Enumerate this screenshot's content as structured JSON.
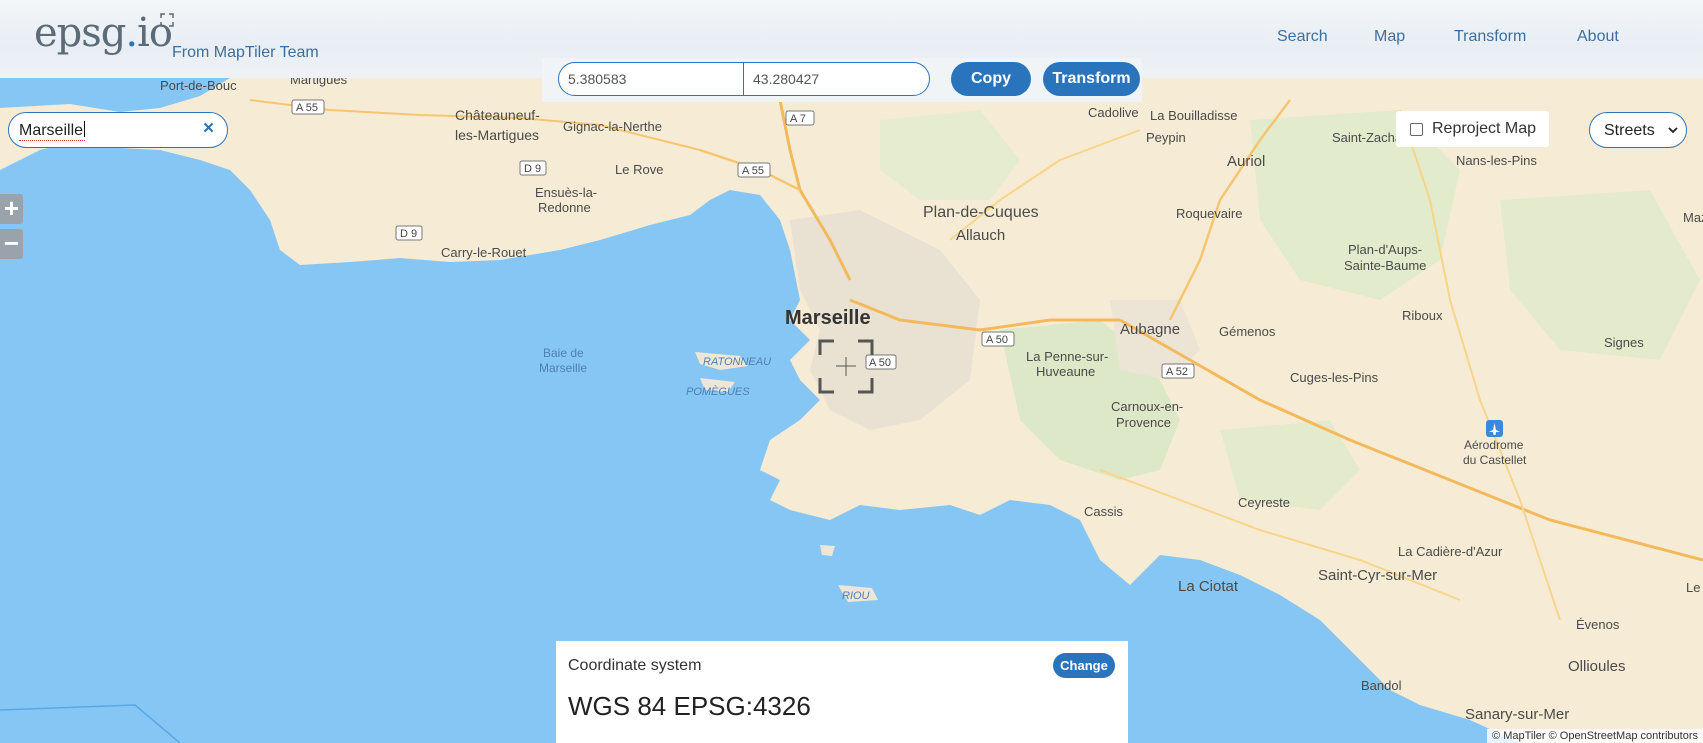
{
  "app": {
    "logo_text": "epsg.io",
    "logo_main": "epsg",
    "logo_dot": ".",
    "logo_tld": "io",
    "team": "From MapTiler Team"
  },
  "nav": {
    "items": [
      "Search",
      "Map",
      "Transform",
      "About"
    ]
  },
  "coords": {
    "x": "5.380583",
    "y": "43.280427",
    "copy_label": "Copy",
    "transform_label": "Transform"
  },
  "search": {
    "value": "Marseille"
  },
  "zoom": {
    "in": "+",
    "out": "−"
  },
  "reproject": {
    "label": "Reproject Map",
    "checked": false
  },
  "map_style": {
    "selected": "Streets"
  },
  "coord_system": {
    "title": "Coordinate system",
    "value": "WGS 84 EPSG:4326",
    "change_label": "Change"
  },
  "attribution": "© MapTiler © OpenStreetMap contributors",
  "map": {
    "main_city": "Marseille",
    "places": [
      "Port-de-Bouc",
      "Martigues",
      "Châteauneuf-",
      "les-Martigues",
      "Gignac-la-Nerthe",
      "Le Rove",
      "Ensuès-la-",
      "Redonne",
      "Carry-le-Rouet",
      "Cadolive",
      "La Bouilladisse",
      "Peypin",
      "Saint-Zacharie",
      "Nans-les-Pins",
      "Auriol",
      "Roquevaire",
      "Plan-de-Cuques",
      "Allauch",
      "Plan-d'Aups-",
      "Sainte-Baume",
      "Aubagne",
      "Gémenos",
      "Riboux",
      "Signes",
      "La Penne-sur-",
      "Huveaune",
      "Carnoux-en-",
      "Provence",
      "Cuges-les-Pins",
      "Aérodrome",
      "du Castellet",
      "Cassis",
      "Ceyreste",
      "La Cadière-d'Azur",
      "Saint-Cyr-sur-Mer",
      "La Ciotat",
      "Évenos",
      "Ollioules",
      "Bandol",
      "Sanary-sur-Mer",
      "Le Castellet",
      "Mazaugues"
    ],
    "water_labels": [
      "Baie de",
      "Marseille"
    ],
    "islands": [
      "RATONNEAU",
      "POMÈGUES",
      "RIOU"
    ],
    "roads": [
      "A 55",
      "A 7",
      "D 9",
      "A 50",
      "A 52"
    ]
  }
}
